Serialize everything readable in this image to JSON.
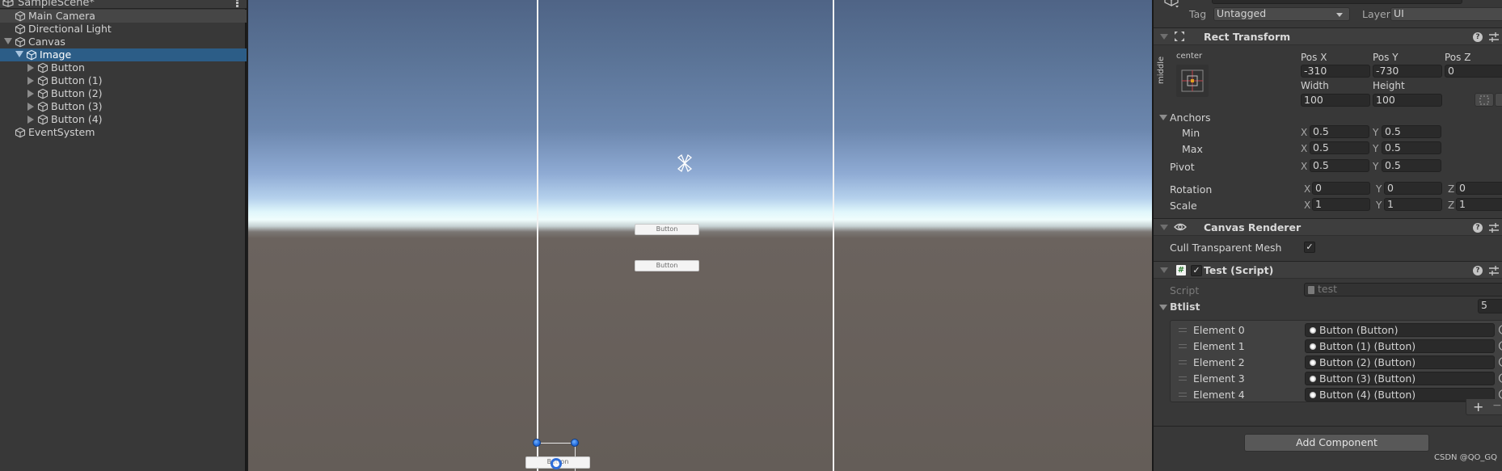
{
  "hierarchy": {
    "scene_title": "SampleScene*",
    "menu_icon": "kebab-menu-icon",
    "items": [
      {
        "label": "Main Camera",
        "depth": 0,
        "expander": "none"
      },
      {
        "label": "Directional Light",
        "depth": 0,
        "expander": "none"
      },
      {
        "label": "Canvas",
        "depth": 0,
        "expander": "expanded"
      },
      {
        "label": "Image",
        "depth": 1,
        "expander": "expanded",
        "selected": true
      },
      {
        "label": "Button",
        "depth": 2,
        "expander": "collapsed"
      },
      {
        "label": "Button (1)",
        "depth": 2,
        "expander": "collapsed"
      },
      {
        "label": "Button (2)",
        "depth": 2,
        "expander": "collapsed"
      },
      {
        "label": "Button (3)",
        "depth": 2,
        "expander": "collapsed"
      },
      {
        "label": "Button (4)",
        "depth": 2,
        "expander": "collapsed"
      },
      {
        "label": "EventSystem",
        "depth": 0,
        "expander": "none"
      }
    ]
  },
  "scene": {
    "buttons": [
      {
        "label": "Button"
      },
      {
        "label": "Button"
      },
      {
        "label": "Button"
      }
    ],
    "colors": {
      "sky_top": "#4f6486",
      "horizon": "#f0fdfd",
      "ground": "#645d58",
      "handle": "#1a62d6"
    }
  },
  "inspector": {
    "tag_label": "Tag",
    "tag_value": "Untagged",
    "layer_label": "Layer",
    "layer_value": "UI",
    "rect_transform": {
      "title": "Rect Transform",
      "anchor_h": "center",
      "anchor_v": "middle",
      "pos_x_label": "Pos X",
      "pos_y_label": "Pos Y",
      "pos_z_label": "Pos Z",
      "pos_x": "-310",
      "pos_y": "-730",
      "pos_z": "0",
      "width_label": "Width",
      "height_label": "Height",
      "width": "100",
      "height": "100",
      "anchors_label": "Anchors",
      "min_label": "Min",
      "max_label": "Max",
      "min_x": "0.5",
      "min_y": "0.5",
      "max_x": "0.5",
      "max_y": "0.5",
      "pivot_label": "Pivot",
      "pivot_x": "0.5",
      "pivot_y": "0.5",
      "rotation_label": "Rotation",
      "rot_x": "0",
      "rot_y": "0",
      "rot_z": "0",
      "scale_label": "Scale",
      "scale_x": "1",
      "scale_y": "1",
      "scale_z": "1",
      "axis_x": "X",
      "axis_y": "Y",
      "axis_z": "Z"
    },
    "canvas_renderer": {
      "title": "Canvas Renderer",
      "cull_label": "Cull Transparent Mesh",
      "cull_checked": "✓"
    },
    "test_script": {
      "title": "Test (Script)",
      "enabled": "✓",
      "script_label": "Script",
      "script_value": "test",
      "list_label": "Btlist",
      "list_size": "5",
      "elements": [
        {
          "label": "Element 0",
          "value": "Button (Button)"
        },
        {
          "label": "Element 1",
          "value": "Button (1) (Button)"
        },
        {
          "label": "Element 2",
          "value": "Button (2) (Button)"
        },
        {
          "label": "Element 3",
          "value": "Button (3) (Button)"
        },
        {
          "label": "Element 4",
          "value": "Button (4) (Button)"
        }
      ],
      "add_symbol": "+",
      "remove_symbol": "−"
    },
    "help_symbol": "?",
    "add_component_label": "Add Component",
    "watermark": "CSDN @QO_GQ"
  }
}
